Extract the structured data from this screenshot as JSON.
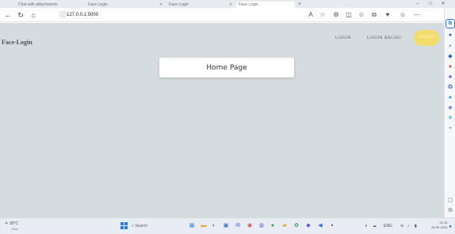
{
  "browser": {
    "tabs": [
      {
        "label": "Chat with attachments"
      },
      {
        "label": "Face Login"
      },
      {
        "label": "Face Login"
      },
      {
        "label": "Face Login"
      }
    ],
    "new_tab_glyph": "+",
    "window_controls": [
      "–",
      "□",
      "✕"
    ],
    "url": "127.0.0.1:5000",
    "nav_icons": [
      "back-arrow-icon",
      "refresh-icon",
      "home-icon"
    ],
    "toolbar_icons": [
      "read-aloud-icon",
      "favorite-star-icon",
      "extensions-icon",
      "split-screen-icon",
      "favorites-icon",
      "collections-icon",
      "browser-essentials-icon",
      "profile-icon",
      "more-icon"
    ]
  },
  "site": {
    "brand": "Face-Login",
    "nav": {
      "login": "LOGIN",
      "login_recog": "LOGIN RECOG",
      "pill": "SIGN UP"
    },
    "home_title": "Home Page",
    "colors": {
      "background": "#d5dcdf",
      "pill": "#f1dc6c",
      "card": "#ffffff"
    }
  },
  "sidebar": {
    "bing_label": "b",
    "icons": [
      "copilot-icon",
      "search-icon",
      "shopping-tag-icon",
      "tools-icon",
      "games-icon",
      "office-icon",
      "outlook-icon",
      "edge-drop-icon",
      "design-icon",
      "add-icon",
      "sidebar-layout-icon",
      "settings-icon"
    ]
  },
  "taskbar": {
    "weather_temp": "30°C",
    "weather_desc": "Haze",
    "search_label": "Search",
    "apps": [
      "widgets-icon",
      "file-explorer-icon",
      "edge-icon",
      "store-icon",
      "mail-icon",
      "chrome-icon",
      "teams-icon",
      "whatsapp-icon",
      "folder-icon",
      "photos-icon",
      "chat-icon",
      "vscode-icon",
      "terminal-icon"
    ],
    "lang": "ENG",
    "lang_sub": "IN",
    "time": "22:16",
    "date": "25-09-2023"
  }
}
